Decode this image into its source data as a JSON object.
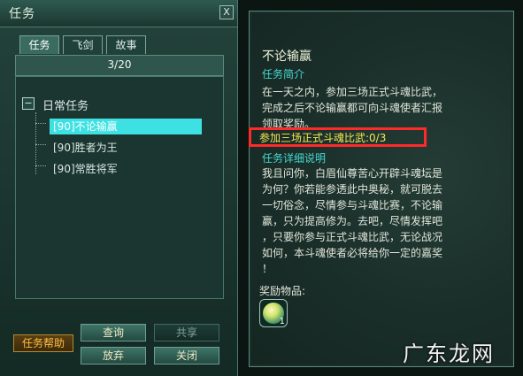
{
  "window": {
    "title": "任务",
    "close_label": "X",
    "tabs": [
      "任务",
      "飞剑",
      "故事"
    ],
    "counter": "3/20"
  },
  "tree": {
    "collapse_symbol": "−",
    "group": "日常任务",
    "items": [
      {
        "label": "[90]不论输赢",
        "selected": true
      },
      {
        "label": "[90]胜者为王",
        "selected": false
      },
      {
        "label": "[90]常胜将军",
        "selected": false
      }
    ]
  },
  "buttons": {
    "help": "任务帮助",
    "query": "查询",
    "share": "共享",
    "abandon": "放弃",
    "close": "关闭"
  },
  "detail": {
    "title": "不论输赢",
    "intro_heading": "任务简介",
    "intro_text": "在一天之内，参加三场正式斗魂比武，\n完成之后不论输赢都可向斗魂使者汇报\n领取奖励。",
    "progress": "参加三场正式斗魂比武:0/3",
    "detail_heading": "任务详细说明",
    "detail_text": "我且问你，白眉仙尊苦心开辟斗魂坛是\n为何？你若能参透此中奥秘，就可脱去\n一切俗念，尽情参与斗魂比赛，不论输\n赢，只为提高修为。去吧，尽情发挥吧\n，只要你参与正式斗魂比武，无论战况\n如何，本斗魂使者必将给你一定的嘉奖\n！",
    "reward_label": "奖励物品:",
    "reward_qty": "1"
  },
  "watermark": "广东龙网",
  "colors": {
    "highlight_border": "#ff2a2a",
    "progress_text": "#f6e650",
    "section_heading": "#47d9d2",
    "selected_row": "#3de1e3"
  }
}
